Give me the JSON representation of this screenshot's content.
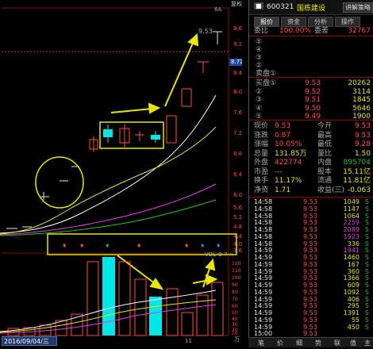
{
  "header": {
    "mode_label": "复权",
    "indicator_short": "6A",
    "badge": "■",
    "code": "600321",
    "name": "国栋建设",
    "button": "讲解策略"
  },
  "tabs": [
    "报价",
    "资金",
    "分析",
    "操作"
  ],
  "price_axis": [
    "9.6",
    "9.2",
    "8.72",
    "8.4",
    "8.0",
    "7.6",
    "7.2",
    "6.8",
    "6.4",
    "6.0",
    "5.6",
    "5.2",
    "4.8",
    "4.4",
    "4.0",
    "3.6"
  ],
  "vol_axis": [
    "120",
    "110",
    "100",
    "90",
    "80",
    "70",
    "60",
    "50",
    "40",
    "30",
    "20",
    "10"
  ],
  "vol_unit": "万",
  "date_label": "2016/09/04/三",
  "month_label": "11",
  "high_label": "9.53",
  "ind_label": "VOL ⚙ ? ×",
  "colors": {
    "up": "#ff4a4a",
    "down": "#00e5e5",
    "ma5": "#ffffff",
    "ma10": "#e6e600",
    "ma20": "#e040e0",
    "ma30": "#19c119",
    "annot": "#e6e600"
  },
  "quote": {
    "ratio": {
      "label": "委比",
      "value": "100.00%",
      "label2": "委差",
      "value2": "32767"
    },
    "sell_labels": [
      "⑤",
      "④",
      "③",
      "②",
      "卖盘①"
    ],
    "buy": [
      {
        "label": "买盘①",
        "price": "9.53",
        "vol": "20262"
      },
      {
        "label": "②",
        "price": "9.52",
        "vol": "3114"
      },
      {
        "label": "③",
        "price": "9.51",
        "vol": "1845"
      },
      {
        "label": "④",
        "price": "9.50",
        "vol": "5646"
      },
      {
        "label": "⑤",
        "price": "9.49",
        "vol": "1900"
      }
    ],
    "stats": [
      {
        "l1": "现价",
        "v1": "9.53",
        "l2": "今开",
        "v2": "9.53"
      },
      {
        "l1": "涨跌",
        "v1": "0.87",
        "l2": "最高",
        "v2": "9.53"
      },
      {
        "l1": "涨幅",
        "v1": "10.05%",
        "l2": "最低",
        "v2": "9.28"
      },
      {
        "l1": "总量",
        "v1": "131.85万",
        "l2": "量比",
        "v2": "1.50"
      },
      {
        "l1": "外盘",
        "v1": "422774",
        "l2": "内盘",
        "v2": "895704"
      },
      {
        "l1": "市盈",
        "v1": "---",
        "l2": "股本",
        "v2": "15.11亿"
      },
      {
        "l1": "换手",
        "v1": "11.17%",
        "l2": "流通",
        "v2": "11.81亿"
      },
      {
        "l1": "净资",
        "v1": "1.71",
        "l2": "收益(三)",
        "v2": "-0.063"
      }
    ],
    "ticks": [
      {
        "t": "14:58",
        "p": "9.53",
        "v": "1049",
        "s": "S",
        "vc": "yellow"
      },
      {
        "t": "14:58",
        "p": "9.53",
        "v": "1147",
        "s": "S",
        "vc": "yellow"
      },
      {
        "t": "14:58",
        "p": "9.53",
        "v": "1064",
        "s": "S",
        "vc": "yellow"
      },
      {
        "t": "14:58",
        "p": "9.53",
        "v": "2259",
        "s": "S",
        "vc": "magenta"
      },
      {
        "t": "14:58",
        "p": "9.53",
        "v": "2089",
        "s": "S",
        "vc": "magenta"
      },
      {
        "t": "14:58",
        "p": "9.53",
        "v": "1923",
        "s": "S",
        "vc": "magenta"
      },
      {
        "t": "14:58",
        "p": "9.53",
        "v": "336",
        "s": "S",
        "vc": "yellow"
      },
      {
        "t": "14:59",
        "p": "9.53",
        "v": "1941",
        "s": "S",
        "vc": "magenta"
      },
      {
        "t": "14:59",
        "p": "9.53",
        "v": "1460",
        "s": "S",
        "vc": "yellow"
      },
      {
        "t": "14:59",
        "p": "9.53",
        "v": "167",
        "s": "S",
        "vc": "yellow"
      },
      {
        "t": "14:59",
        "p": "9.53",
        "v": "360",
        "s": "S",
        "vc": "yellow"
      },
      {
        "t": "14:59",
        "p": "9.53",
        "v": "1366",
        "s": "S",
        "vc": "yellow"
      },
      {
        "t": "14:59",
        "p": "9.53",
        "v": "609",
        "s": "S",
        "vc": "yellow"
      },
      {
        "t": "14:59",
        "p": "9.53",
        "v": "1092",
        "s": "S",
        "vc": "yellow"
      },
      {
        "t": "14:59",
        "p": "9.53",
        "v": "406",
        "s": "S",
        "vc": "yellow"
      },
      {
        "t": "14:59",
        "p": "9.53",
        "v": "295",
        "s": "S",
        "vc": "yellow"
      },
      {
        "t": "14:59",
        "p": "9.53",
        "v": "1391",
        "s": "S",
        "vc": "yellow"
      },
      {
        "t": "14:59",
        "p": "9.53",
        "v": "55",
        "s": "S",
        "vc": "yellow"
      },
      {
        "t": "14:59",
        "p": "9.53",
        "v": "450",
        "s": "S",
        "vc": "yellow"
      },
      {
        "t": "15:00",
        "p": "9.53",
        "v": "",
        "s": "",
        "vc": "yellow"
      }
    ]
  },
  "bottom_tabs": [
    "笔",
    "价",
    "细",
    "势",
    "联",
    "值",
    "主"
  ]
}
